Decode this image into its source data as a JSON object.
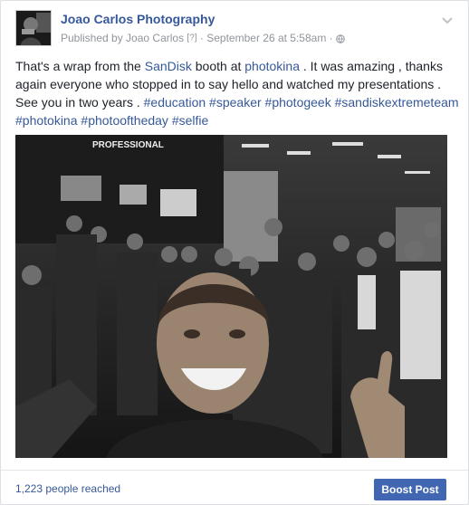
{
  "post": {
    "page_name": "Joao Carlos Photography",
    "published_by_prefix": "Published by Joao Carlos",
    "help_marker": "[?]",
    "separator": "·",
    "timestamp": "September 26 at 5:58am",
    "separator2": "·",
    "privacy_icon": "globe-icon",
    "menu_icon": "chevron-down-icon",
    "text": {
      "t1": "That's a wrap from the ",
      "sandisk": "SanDisk",
      "t2": " booth at ",
      "photokina": "photokina",
      "t3": " . It was amazing , thanks again everyone who stopped in to say hello and watched my presentations . See you in two years . ",
      "hashtags": [
        "#education",
        "#speaker",
        "#photogeek",
        "#sandiskextremeteam",
        "#photokina",
        "#photooftheday",
        "#selfie"
      ]
    },
    "photo_sign": "PROFESSIONAL"
  },
  "footer": {
    "reach": "1,223 people reached",
    "boost_label": "Boost Post"
  },
  "colors": {
    "link": "#365899",
    "boost": "#4267b2",
    "meta": "#90949c"
  }
}
